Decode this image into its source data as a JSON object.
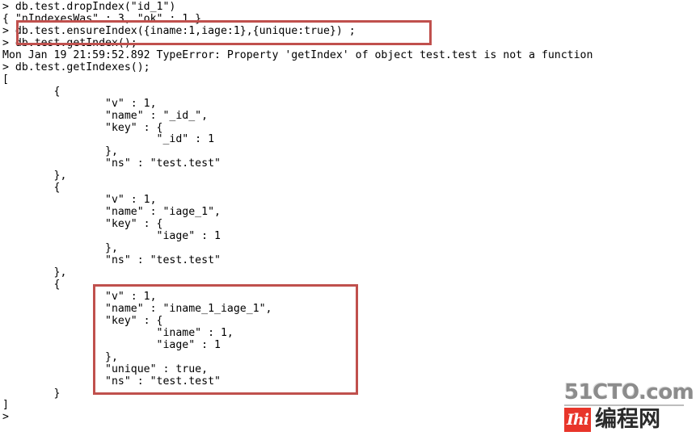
{
  "terminal": {
    "lines": [
      "> db.test.dropIndex(\"id_1\")",
      "{ \"nIndexesWas\" : 3, \"ok\" : 1 }",
      "> db.test.ensureIndex({iname:1,iage:1},{unique:true}) ;",
      "> db.test.getIndex();",
      "Mon Jan 19 21:59:52.892 TypeError: Property 'getIndex' of object test.test is not a function",
      "> db.test.getIndexes();",
      "[",
      "        {",
      "                \"v\" : 1,",
      "                \"name\" : \"_id_\",",
      "                \"key\" : {",
      "                        \"_id\" : 1",
      "                },",
      "                \"ns\" : \"test.test\"",
      "        },",
      "        {",
      "                \"v\" : 1,",
      "                \"name\" : \"iage_1\",",
      "                \"key\" : {",
      "                        \"iage\" : 1",
      "                },",
      "                \"ns\" : \"test.test\"",
      "        },",
      "        {",
      "                \"v\" : 1,",
      "                \"name\" : \"iname_1_iage_1\",",
      "                \"key\" : {",
      "                        \"iname\" : 1,",
      "                        \"iage\" : 1",
      "                },",
      "                \"unique\" : true,",
      "                \"ns\" : \"test.test\"",
      "        }",
      "]",
      ">"
    ],
    "prompt_symbol": ">",
    "text_color": "#000000",
    "background_color": "#ffffff"
  },
  "annotations": {
    "border_color": "#c0504d",
    "boxes": [
      {
        "name": "ensure-index-command",
        "target_text": "> db.test.ensureIndex({iname:1,iage:1},{unique:true}) ;"
      },
      {
        "name": "unique-index-entry",
        "target_text": "\"name\" : \"iname_1_iage_1\", \"unique\" : true"
      }
    ]
  },
  "watermark": {
    "site": "51CTO.com",
    "badge_glyph": "Ihi",
    "chinese_name": "编程网",
    "badge_color": "#e8352a",
    "site_color": "#8c8c8c",
    "name_color": "#2b2b2b"
  }
}
